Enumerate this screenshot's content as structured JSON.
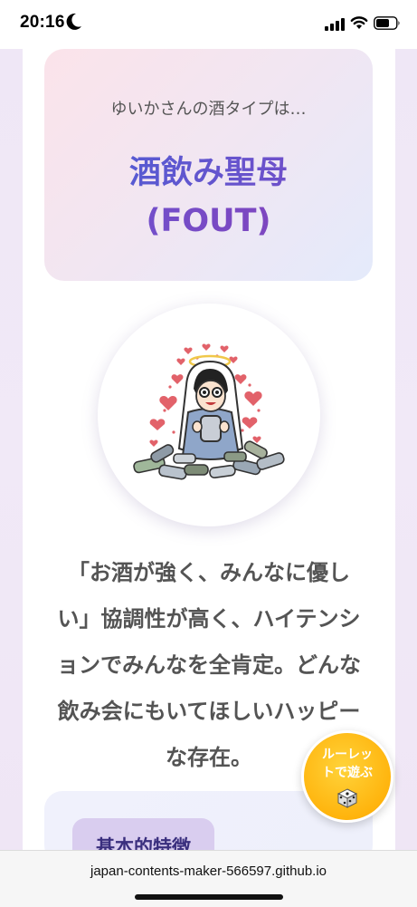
{
  "status_bar": {
    "time": "20:16"
  },
  "result": {
    "intro": "ゆいかさんの酒タイプは…",
    "type_name": "酒飲み聖母",
    "type_code": "(FOUT)"
  },
  "description": {
    "lines": [
      "「お酒が強く、みんなに優し",
      "い」協調性が高く、ハイテンシ",
      "ョンでみんなを全肯定。どんな",
      "飲み会にもいてほしいハッピー",
      "な存在。"
    ]
  },
  "features": {
    "tag_label": "基本的特徴"
  },
  "roulette": {
    "label_line1": "ルーレッ",
    "label_line2": "トで遊ぶ",
    "icon": "dice-icon"
  },
  "browser": {
    "url": "japan-contents-maker-566597.github.io"
  },
  "colors": {
    "accent_blue": "#4b5fd6",
    "accent_purple": "#7a4bc6",
    "roulette_yellow": "#ffb40d"
  }
}
